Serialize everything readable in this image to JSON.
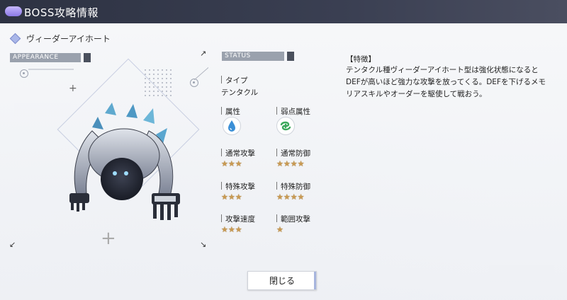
{
  "header": {
    "title": "BOSS攻略情報"
  },
  "boss": {
    "name": "ヴィーダーアイホート"
  },
  "tags": {
    "appearance": "APPEARANCE",
    "status": "STATUS"
  },
  "status": {
    "type_label": "タイプ",
    "type_value": "テンタクル",
    "attribute_label": "属性",
    "weak_attribute_label": "弱点属性",
    "attribute_icon": "water-drop-icon",
    "weak_attribute_icon": "wind-swirl-icon",
    "stats": [
      {
        "label": "通常攻撃",
        "stars": 3
      },
      {
        "label": "通常防御",
        "stars": 4
      },
      {
        "label": "特殊攻撃",
        "stars": 3
      },
      {
        "label": "特殊防御",
        "stars": 4
      },
      {
        "label": "攻撃速度",
        "stars": 3
      },
      {
        "label": "範囲攻撃",
        "stars": 1
      }
    ]
  },
  "description": {
    "title": "【特徴】",
    "text": "テンタクル種ヴィーダーアイホート型は強化状態になるとDEFが高いほど強力な攻撃を放ってくる。DEFを下げるメモリアスキルやオーダーを駆使して戦おう。"
  },
  "buttons": {
    "close_label": "閉じる"
  },
  "colors": {
    "header_bg": "#2d3242",
    "accent": "#a7b5de",
    "star": "#c99a52"
  }
}
